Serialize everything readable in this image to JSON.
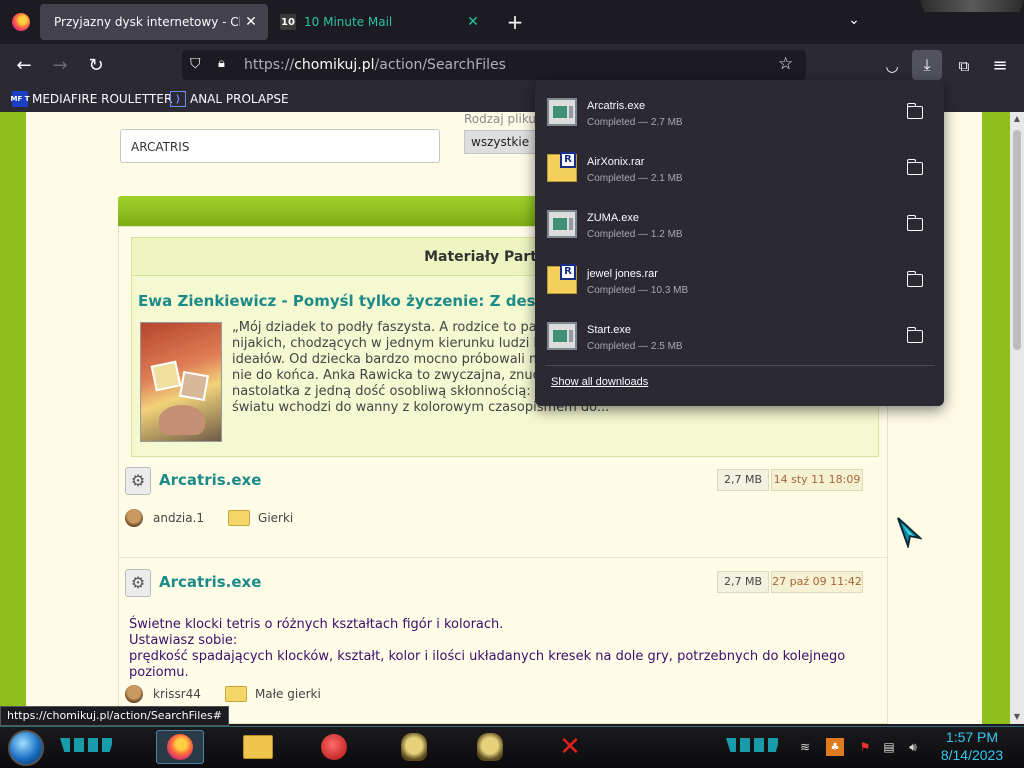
{
  "browser": {
    "tabs": [
      {
        "label": "Przyjazny dysk internetowy - Chomikuj.pl",
        "active": true
      },
      {
        "label": "10 Minute Mail",
        "favicon_text": "10",
        "active": false
      }
    ],
    "url_prefix": "https://",
    "url_host": "chomikuj.pl",
    "url_path": "/action/SearchFiles",
    "bookmarks": [
      {
        "label": "MEDIAFIRE ROULETTER",
        "icon_text": "MF T"
      },
      {
        "label": "ANAL PROLAPSE"
      }
    ]
  },
  "page": {
    "search_value": "ARCATRIS",
    "rodzaj_label": "Rodzaj pliku",
    "rodzaj_value": "wszystkie",
    "partner_title": "Materiały Partnerów",
    "book_title": "Ewa Zienkiewicz - Pomyśl tylko życzenie: Z deszczu pod rynnę",
    "book_blurb": "„Mój dziadek to podły faszysta. A rodzice to pantoflarze i koszmarni mieszczuchów. Bezbarwnych, nijakich, chodzących w jednym kierunku ludzi bez ambicji, życiowego sprytu czy wzniosłych ideałów. Od dziecka bardzo mocno próbowali mnie uchronić przed takim samym losem, ale chyba nie do końca. Anka Rawicka to zwyczajna, znudzona rutyną i szarością życia szesnastoletnia nastolatka z jedną dość osobliwą skłonnością: kiedy jest wściekła, na złość rodzicom i całemu światu wchodzi do wanny z kolorowym czasopismem do...",
    "files": [
      {
        "name": "Arcatris.exe",
        "size": "2,7 MB",
        "date": "14 sty 11 18:09",
        "user": "andzia.1",
        "folder": "Gierki",
        "description": []
      },
      {
        "name": "Arcatris.exe",
        "size": "2,7 MB",
        "date": "27 paź 09 11:42",
        "user": "krissr44",
        "folder": "Małe gierki",
        "description": [
          "Świetne klocki tetris o różnych kształtach figór i kolorach.",
          "Ustawiasz sobie:",
          "prędkość spadających klocków, kształt, kolor i ilości układanych kresek na dole gry, potrzebnych do kolejnego poziomu."
        ]
      }
    ]
  },
  "downloads": {
    "items": [
      {
        "name": "Arcatris.exe",
        "status": "Completed — 2.7 MB",
        "type": "exe"
      },
      {
        "name": "AirXonix.rar",
        "status": "Completed — 2.1 MB",
        "type": "rar"
      },
      {
        "name": "ZUMA.exe",
        "status": "Completed — 1.2 MB",
        "type": "exe"
      },
      {
        "name": "jewel jones.rar",
        "status": "Completed — 10.3 MB",
        "type": "rar"
      },
      {
        "name": "Start.exe",
        "status": "Completed — 2.5 MB",
        "type": "exe"
      }
    ],
    "show_all": "Show all downloads"
  },
  "status_url": "https://chomikuj.pl/action/SearchFiles#",
  "taskbar": {
    "time": "1:57 PM",
    "date": "8/14/2023"
  },
  "colors": {
    "accent_teal": "#1d8a8a",
    "page_green": "#8dc01a",
    "clock_cyan": "#36c8f0",
    "tab_inactive_text": "#2ac3a2"
  }
}
